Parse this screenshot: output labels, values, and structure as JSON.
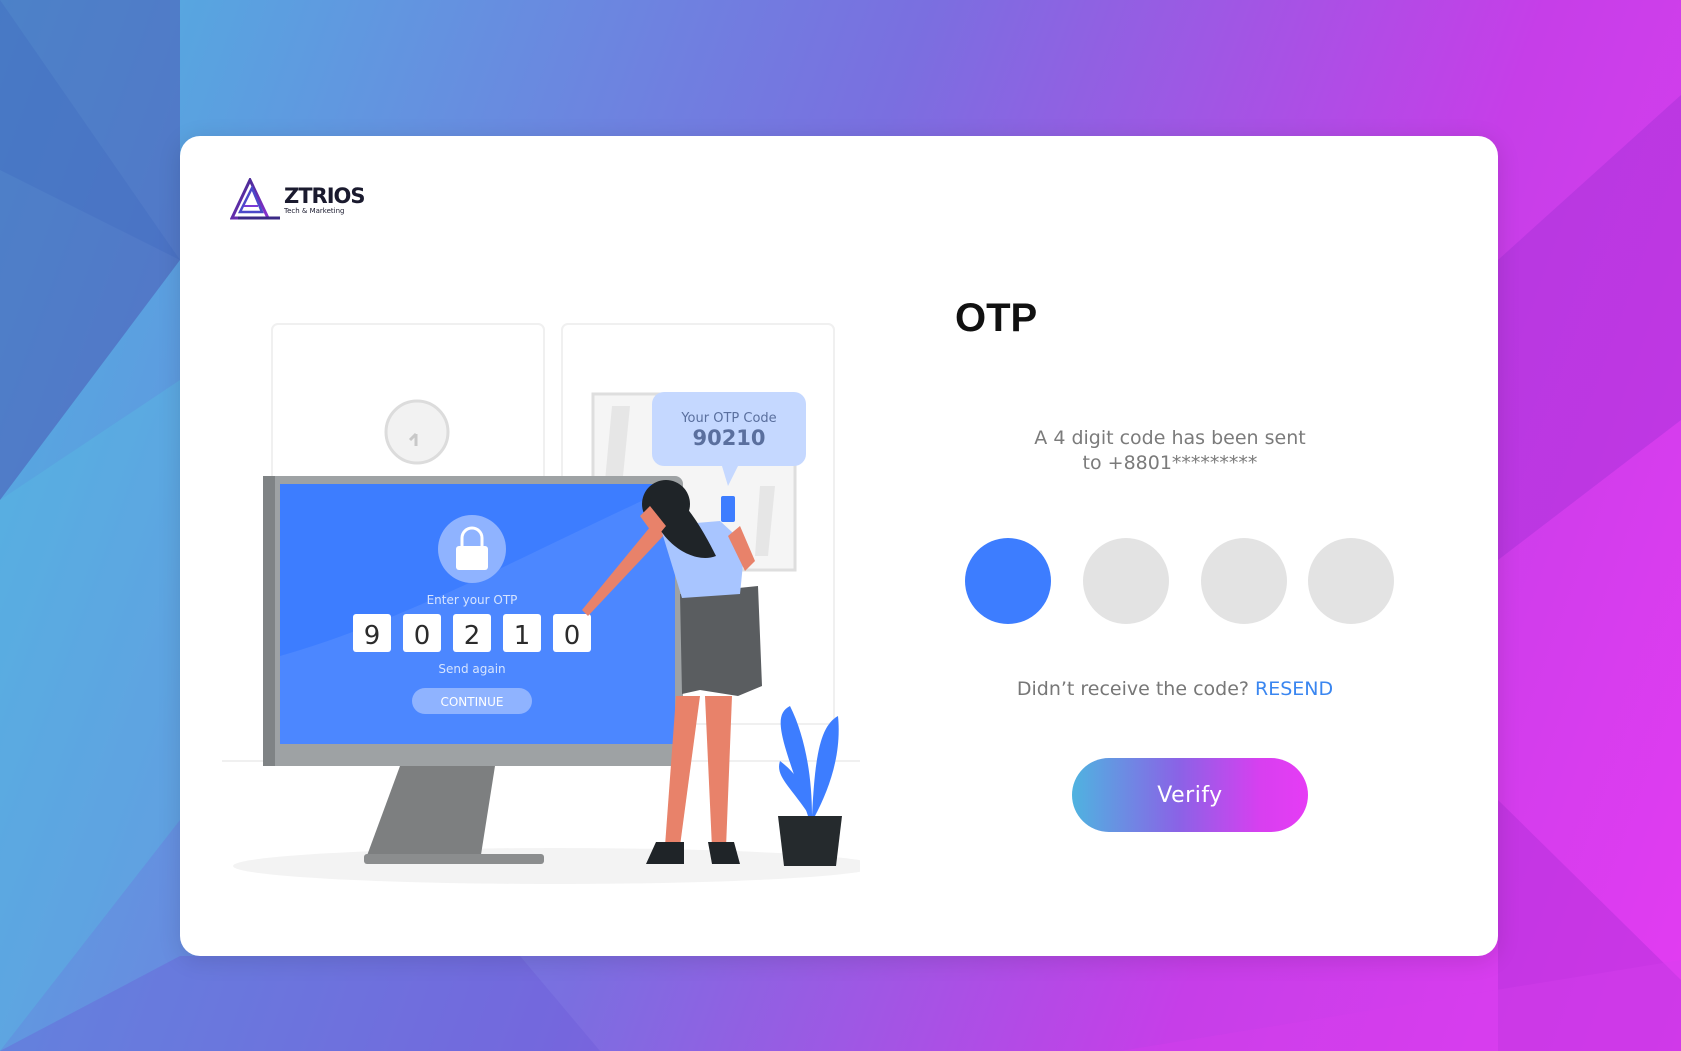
{
  "brand": {
    "name": "ZTRIOS",
    "tagline": "Tech & Marketing"
  },
  "illustration": {
    "bubble_title": "Your OTP Code",
    "bubble_code": "90210",
    "screen_prompt": "Enter your OTP",
    "screen_digits": [
      "9",
      "0",
      "2",
      "1",
      "0"
    ],
    "send_again": "Send again",
    "continue_label": "CONTINUE"
  },
  "otp": {
    "title": "OTP",
    "description_line1": "A 4 digit code has been sent",
    "description_line2": "to +8801*********",
    "digits": [
      "",
      "",
      "",
      ""
    ],
    "active_index": 0,
    "resend_prompt": "Didn’t receive the code?",
    "resend_link": "RESEND",
    "verify_label": "Verify"
  },
  "colors": {
    "accent": "#3d7dff",
    "inactive_digit": "#e3e3e3",
    "link": "#3a86f0",
    "bg_gradient_start": "#4fb3e0",
    "bg_gradient_end": "#e33cf2"
  }
}
